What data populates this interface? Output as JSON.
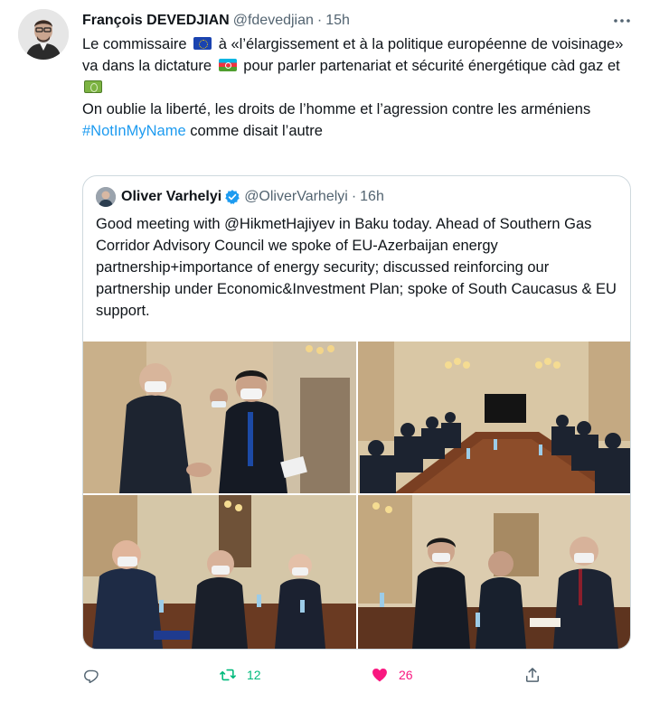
{
  "tweet": {
    "author": {
      "name": "François DEVEDJIAN",
      "handle": "@fdevedjian",
      "time": "15h"
    },
    "text": {
      "line1_a": "Le commissaire",
      "line1_b": "à «l’élargissement et à la politique européenne de voisinage» va dans la dictature",
      "line1_c": "pour parler partenariat et sécurité énergétique càd gaz et",
      "line2": "On oublie la liberté, les droits de l’homme et l’agression contre les arméniens",
      "hashtag": "#NotInMyName",
      "line3_rest": "comme disait l’autre"
    },
    "emoji": [
      "eu-flag",
      "azerbaijan-flag",
      "banknote-emoji"
    ]
  },
  "quote": {
    "author": {
      "name": "Oliver Varhelyi",
      "handle": "@OliverVarhelyi",
      "time": "16h"
    },
    "text": "Good meeting with @HikmetHajiyev in Baku today. Ahead of Southern Gas Corridor Advisory Council we spoke of EU-Azerbaijan energy partnership+importance of energy security; discussed reinforcing our partnership under Economic&Investment Plan; spoke of South Caucasus & EU support.",
    "photos": [
      "handshake-photo",
      "meeting-table-photo",
      "meeting-photo-left",
      "meeting-photo-right"
    ]
  },
  "actions": {
    "reply": {
      "icon": "reply-icon",
      "count": ""
    },
    "retweet": {
      "icon": "retweet-icon",
      "count": "12"
    },
    "like": {
      "icon": "heart-icon",
      "count": "26"
    },
    "share": {
      "icon": "share-icon",
      "count": ""
    }
  },
  "colors": {
    "link": "#1d9bf0",
    "retweet": "#00ba7c",
    "like": "#f91880",
    "muted": "#536471"
  }
}
